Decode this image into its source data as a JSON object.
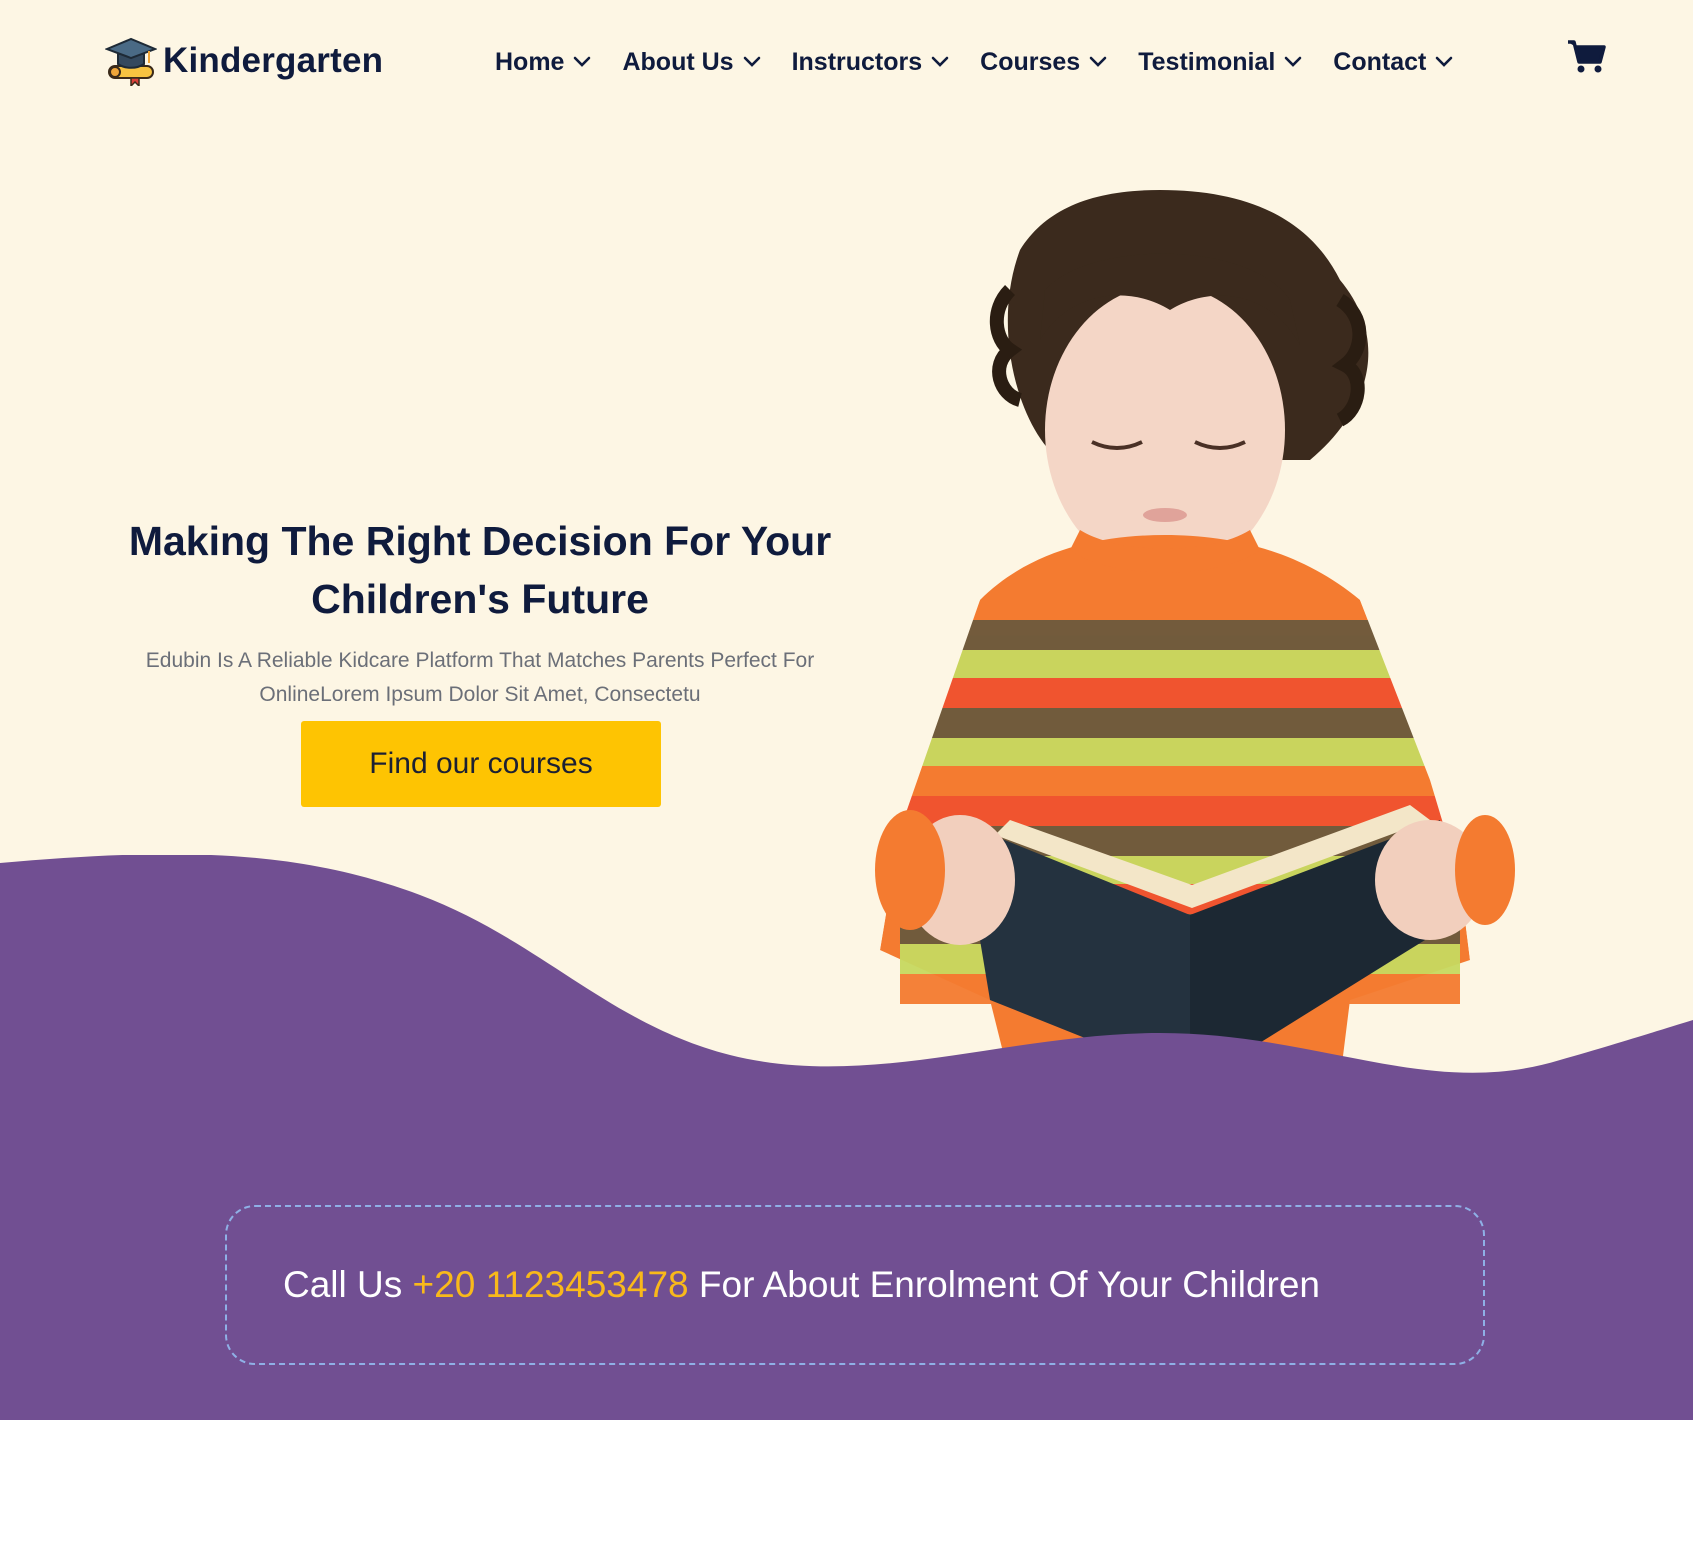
{
  "brand": {
    "name": "Kindergarten",
    "logo_icon": "graduation-cap-diploma-icon"
  },
  "nav": {
    "items": [
      {
        "label": "Home",
        "icon": "chevron-down-icon"
      },
      {
        "label": "About Us",
        "icon": "chevron-down-icon"
      },
      {
        "label": "Instructors",
        "icon": "chevron-down-icon"
      },
      {
        "label": "Courses",
        "icon": "chevron-down-icon"
      },
      {
        "label": "Testimonial",
        "icon": "chevron-down-icon"
      },
      {
        "label": "Contact",
        "icon": "chevron-down-icon"
      }
    ],
    "cart_icon": "shopping-cart-icon"
  },
  "hero": {
    "title_line1": "Making The Right Decision For Your",
    "title_line2": "Children's Future",
    "subtitle_line1": "Edubin Is A Reliable Kidcare Platform That Matches Parents Perfect For",
    "subtitle_line2": "OnlineLorem Ipsum Dolor Sit Amet, Consectetu",
    "cta_label": "Find our courses",
    "image": "child-reading-book"
  },
  "callout": {
    "prefix": "Call Us ",
    "phone": "+20 1123453478",
    "suffix": " For About Enrolment Of Your Children"
  },
  "colors": {
    "hero_bg": "#fdf6e4",
    "navy": "#0f1b3d",
    "purple": "#714f92",
    "accent_yellow": "#fec402",
    "phone_orange": "#f9b91a",
    "dashed_border": "#8fb0e6"
  }
}
